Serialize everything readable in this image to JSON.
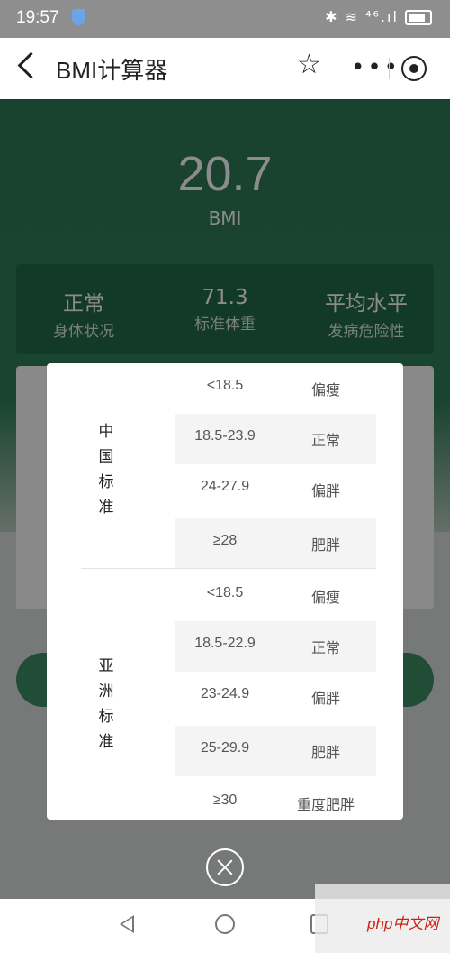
{
  "status_bar": {
    "time": "19:57",
    "icons": "✱ ≋ ⁴⁶.ıl"
  },
  "nav": {
    "title": "BMI计算器"
  },
  "result": {
    "bmi_value": "20.7",
    "bmi_label": "BMI",
    "stats": [
      {
        "value": "正常",
        "label": "身体状况"
      },
      {
        "value": "71.3",
        "label": "标准体重"
      },
      {
        "value": "平均水平",
        "label": "发病危险性"
      }
    ]
  },
  "modal": {
    "groups": [
      {
        "label": "中国标准",
        "rows": [
          {
            "range": "<18.5",
            "class": "偏瘦"
          },
          {
            "range": "18.5-23.9",
            "class": "正常"
          },
          {
            "range": "24-27.9",
            "class": "偏胖"
          },
          {
            "range": "≥28",
            "class": "肥胖"
          }
        ]
      },
      {
        "label": "亚洲标准",
        "rows": [
          {
            "range": "<18.5",
            "class": "偏瘦"
          },
          {
            "range": "18.5-22.9",
            "class": "正常"
          },
          {
            "range": "23-24.9",
            "class": "偏胖"
          },
          {
            "range": "25-29.9",
            "class": "肥胖"
          },
          {
            "range": "≥30",
            "class": "重度肥胖"
          }
        ]
      }
    ]
  },
  "watermark": {
    "text": "php中文网"
  },
  "colors": {
    "brand_green": "#2f7d57",
    "overlay": "rgba(0,0,0,0.45)"
  }
}
